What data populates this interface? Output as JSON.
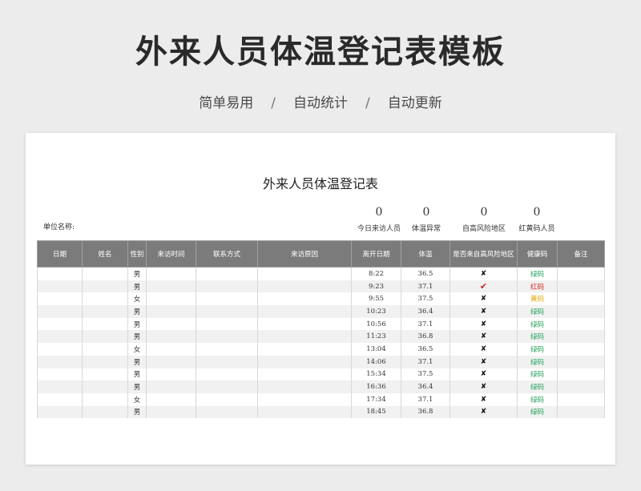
{
  "page": {
    "title": "外来人员体温登记表模板",
    "subtitle": [
      "简单易用",
      "自动统计",
      "自动更新"
    ],
    "separator": "/"
  },
  "sheet": {
    "title": "外来人员体温登记表",
    "unit_label": "单位名称:",
    "stats": [
      {
        "value": "0",
        "label": "今日来访人员"
      },
      {
        "value": "0",
        "label": "体温异常"
      },
      {
        "value": "0",
        "label": "自高风险地区"
      },
      {
        "value": "0",
        "label": "红黄码人员"
      }
    ],
    "columns": [
      "日期",
      "姓名",
      "性别",
      "来访时间",
      "联系方式",
      "来访原因",
      "离开日期",
      "体温",
      "是否来自高风险地区",
      "健康码",
      "备注"
    ],
    "rows": [
      {
        "gender": "男",
        "leave": "8:22",
        "temp": "36.5",
        "risk": "✘",
        "code": "绿码",
        "code_color": "#22a05a"
      },
      {
        "gender": "男",
        "leave": "9:23",
        "temp": "37.1",
        "risk": "✔",
        "code": "红码",
        "code_color": "#d42323"
      },
      {
        "gender": "女",
        "leave": "9:55",
        "temp": "37.5",
        "risk": "✘",
        "code": "黄码",
        "code_color": "#e0a800"
      },
      {
        "gender": "男",
        "leave": "10:23",
        "temp": "36.4",
        "risk": "✘",
        "code": "绿码",
        "code_color": "#22a05a"
      },
      {
        "gender": "男",
        "leave": "10:56",
        "temp": "37.1",
        "risk": "✘",
        "code": "绿码",
        "code_color": "#22a05a"
      },
      {
        "gender": "男",
        "leave": "11:23",
        "temp": "36.8",
        "risk": "✘",
        "code": "绿码",
        "code_color": "#22a05a"
      },
      {
        "gender": "女",
        "leave": "13:04",
        "temp": "36.5",
        "risk": "✘",
        "code": "绿码",
        "code_color": "#22a05a"
      },
      {
        "gender": "男",
        "leave": "14:06",
        "temp": "37.1",
        "risk": "✘",
        "code": "绿码",
        "code_color": "#22a05a"
      },
      {
        "gender": "男",
        "leave": "15:34",
        "temp": "37.5",
        "risk": "✘",
        "code": "绿码",
        "code_color": "#22a05a"
      },
      {
        "gender": "男",
        "leave": "16:36",
        "temp": "36.4",
        "risk": "✘",
        "code": "绿码",
        "code_color": "#22a05a"
      },
      {
        "gender": "女",
        "leave": "17:34",
        "temp": "37.1",
        "risk": "✘",
        "code": "绿码",
        "code_color": "#22a05a"
      },
      {
        "gender": "男",
        "leave": "18:45",
        "temp": "36.8",
        "risk": "✘",
        "code": "绿码",
        "code_color": "#22a05a"
      }
    ]
  },
  "colors": {
    "background": "#ececed",
    "header_fill": "#7b7b7b",
    "alt_row": "#f1f1f1",
    "green_code": "#22a05a",
    "red_code": "#d42323",
    "yellow_code": "#e0a800"
  }
}
